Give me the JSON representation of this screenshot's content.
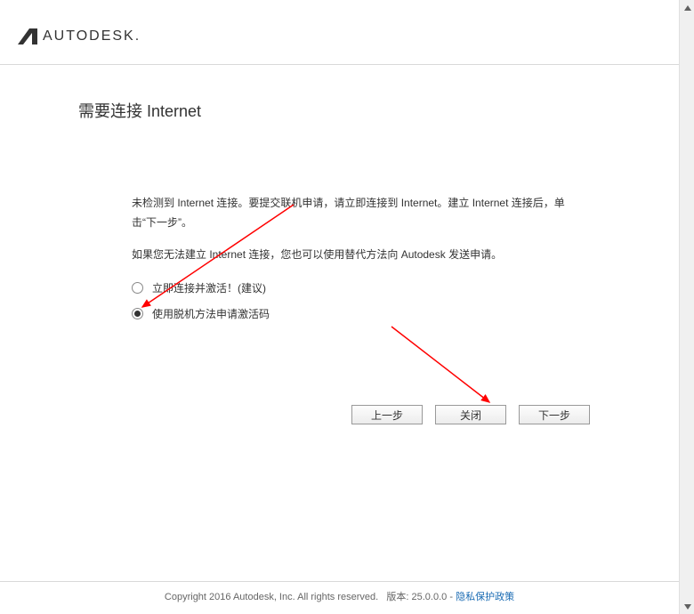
{
  "logo_text": "AUTODESK",
  "logo_suffix": ".",
  "title": "需要连接 Internet",
  "para1": "未检测到 Internet 连接。要提交联机申请，请立即连接到 Internet。建立 Internet 连接后，单击“下一步”。",
  "para2": "如果您无法建立 Internet 连接，您也可以使用替代方法向 Autodesk 发送申请。",
  "radio": {
    "option1": "立即连接并激活！(建议)",
    "option2": "使用脱机方法申请激活码"
  },
  "buttons": {
    "back": "上一步",
    "close": "关闭",
    "next": "下一步"
  },
  "footer": {
    "copyright": "Copyright 2016 Autodesk, Inc. All rights reserved.",
    "version_label": "版本:",
    "version": "25.0.0.0",
    "sep": "-",
    "privacy": "隐私保护政策"
  }
}
